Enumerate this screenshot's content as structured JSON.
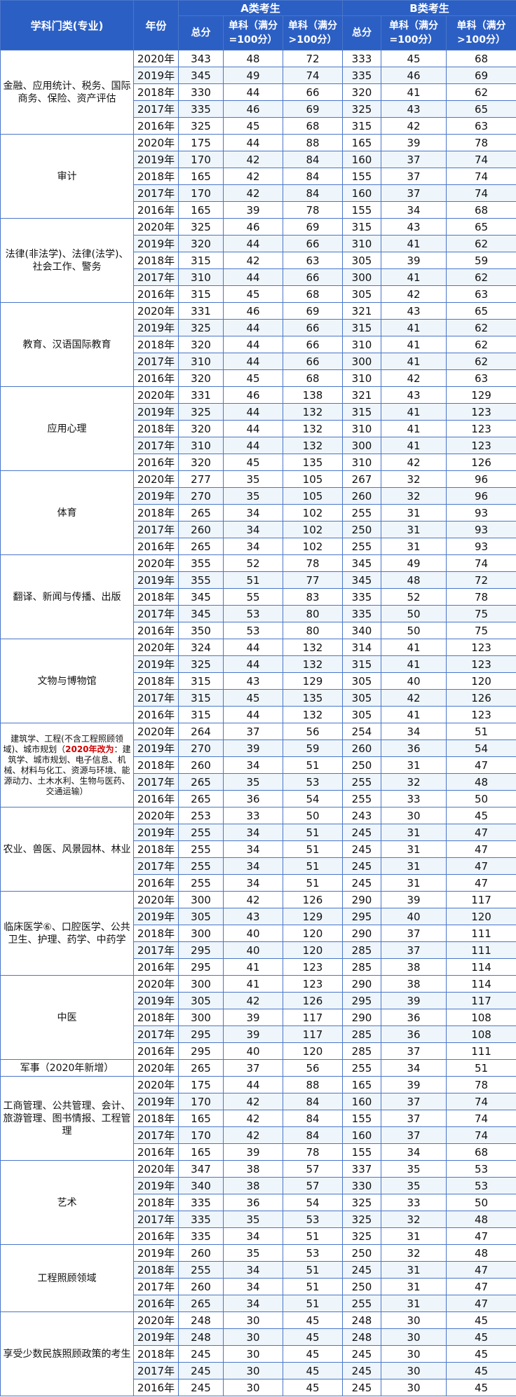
{
  "header": {
    "category": "学科门类(专业)",
    "year": "年份",
    "group_a": "A类考生",
    "group_b": "B类考生",
    "total": "总分",
    "single_100": "单科（满分=100分）",
    "single_over100": "单科（满分>100分）"
  },
  "groups": [
    {
      "name": "金融、应用统计、税务、国际商务、保险、资产评估",
      "rows": [
        [
          "2020年",
          "343",
          "48",
          "72",
          "333",
          "45",
          "68"
        ],
        [
          "2019年",
          "345",
          "49",
          "74",
          "335",
          "46",
          "69"
        ],
        [
          "2018年",
          "330",
          "44",
          "66",
          "320",
          "41",
          "62"
        ],
        [
          "2017年",
          "335",
          "46",
          "69",
          "325",
          "43",
          "65"
        ],
        [
          "2016年",
          "325",
          "45",
          "68",
          "315",
          "42",
          "63"
        ]
      ]
    },
    {
      "name": "审计",
      "rows": [
        [
          "2020年",
          "175",
          "44",
          "88",
          "165",
          "39",
          "78"
        ],
        [
          "2019年",
          "170",
          "42",
          "84",
          "160",
          "37",
          "74"
        ],
        [
          "2018年",
          "165",
          "42",
          "84",
          "155",
          "37",
          "74"
        ],
        [
          "2017年",
          "170",
          "42",
          "84",
          "160",
          "37",
          "74"
        ],
        [
          "2016年",
          "165",
          "39",
          "78",
          "155",
          "34",
          "68"
        ]
      ]
    },
    {
      "name": "法律(非法学)、法律(法学)、社会工作、警务",
      "rows": [
        [
          "2020年",
          "325",
          "46",
          "69",
          "315",
          "43",
          "65"
        ],
        [
          "2019年",
          "320",
          "44",
          "66",
          "310",
          "41",
          "62"
        ],
        [
          "2018年",
          "315",
          "42",
          "63",
          "305",
          "39",
          "59"
        ],
        [
          "2017年",
          "310",
          "44",
          "66",
          "300",
          "41",
          "62"
        ],
        [
          "2016年",
          "315",
          "45",
          "68",
          "305",
          "42",
          "63"
        ]
      ]
    },
    {
      "name": "教育、汉语国际教育",
      "rows": [
        [
          "2020年",
          "331",
          "46",
          "69",
          "321",
          "43",
          "65"
        ],
        [
          "2019年",
          "325",
          "44",
          "66",
          "315",
          "41",
          "62"
        ],
        [
          "2018年",
          "320",
          "44",
          "66",
          "310",
          "41",
          "62"
        ],
        [
          "2017年",
          "310",
          "44",
          "66",
          "300",
          "41",
          "62"
        ],
        [
          "2016年",
          "320",
          "45",
          "68",
          "310",
          "42",
          "63"
        ]
      ]
    },
    {
      "name": "应用心理",
      "rows": [
        [
          "2020年",
          "331",
          "46",
          "138",
          "321",
          "43",
          "129"
        ],
        [
          "2019年",
          "325",
          "44",
          "132",
          "315",
          "41",
          "123"
        ],
        [
          "2018年",
          "320",
          "44",
          "132",
          "310",
          "41",
          "123"
        ],
        [
          "2017年",
          "310",
          "44",
          "132",
          "300",
          "41",
          "123"
        ],
        [
          "2016年",
          "320",
          "45",
          "135",
          "310",
          "42",
          "126"
        ]
      ]
    },
    {
      "name": "体育",
      "rows": [
        [
          "2020年",
          "277",
          "35",
          "105",
          "267",
          "32",
          "96"
        ],
        [
          "2019年",
          "270",
          "35",
          "105",
          "260",
          "32",
          "96"
        ],
        [
          "2018年",
          "265",
          "34",
          "102",
          "255",
          "31",
          "93"
        ],
        [
          "2017年",
          "260",
          "34",
          "102",
          "250",
          "31",
          "93"
        ],
        [
          "2016年",
          "265",
          "34",
          "102",
          "255",
          "31",
          "93"
        ]
      ]
    },
    {
      "name": "翻译、新闻与传播、出版",
      "rows": [
        [
          "2020年",
          "355",
          "52",
          "78",
          "345",
          "49",
          "74"
        ],
        [
          "2019年",
          "355",
          "51",
          "77",
          "345",
          "48",
          "72"
        ],
        [
          "2018年",
          "345",
          "55",
          "83",
          "335",
          "52",
          "78"
        ],
        [
          "2017年",
          "345",
          "53",
          "80",
          "335",
          "50",
          "75"
        ],
        [
          "2016年",
          "350",
          "53",
          "80",
          "340",
          "50",
          "75"
        ]
      ]
    },
    {
      "name": "文物与博物馆",
      "rows": [
        [
          "2020年",
          "324",
          "44",
          "132",
          "314",
          "41",
          "123"
        ],
        [
          "2019年",
          "325",
          "44",
          "132",
          "315",
          "41",
          "123"
        ],
        [
          "2018年",
          "315",
          "43",
          "129",
          "305",
          "40",
          "120"
        ],
        [
          "2017年",
          "315",
          "45",
          "135",
          "305",
          "42",
          "126"
        ],
        [
          "2016年",
          "315",
          "44",
          "132",
          "305",
          "41",
          "123"
        ]
      ]
    },
    {
      "name": "建筑学、工程(不含工程照顾领域)、城市规划（",
      "name_red": "2020年改为",
      "name_tail": "：建筑学、城市规划、电子信息、机械、材料与化工、资源与环境、能源动力、土木水利、生物与医药、交通运输）",
      "rows": [
        [
          "2020年",
          "264",
          "37",
          "56",
          "254",
          "34",
          "51"
        ],
        [
          "2019年",
          "270",
          "39",
          "59",
          "260",
          "36",
          "54"
        ],
        [
          "2018年",
          "260",
          "34",
          "51",
          "250",
          "31",
          "47"
        ],
        [
          "2017年",
          "265",
          "35",
          "53",
          "255",
          "32",
          "48"
        ],
        [
          "2016年",
          "265",
          "36",
          "54",
          "255",
          "33",
          "50"
        ]
      ]
    },
    {
      "name": "农业、兽医、风景园林、林业",
      "rows": [
        [
          "2020年",
          "253",
          "33",
          "50",
          "243",
          "30",
          "45"
        ],
        [
          "2019年",
          "255",
          "34",
          "51",
          "245",
          "31",
          "47"
        ],
        [
          "2018年",
          "255",
          "34",
          "51",
          "245",
          "31",
          "47"
        ],
        [
          "2017年",
          "255",
          "34",
          "51",
          "245",
          "31",
          "47"
        ],
        [
          "2016年",
          "255",
          "34",
          "51",
          "245",
          "31",
          "47"
        ]
      ]
    },
    {
      "name": "临床医学⑥、口腔医学、公共卫生、护理、药学、中药学",
      "rows": [
        [
          "2020年",
          "300",
          "42",
          "126",
          "290",
          "39",
          "117"
        ],
        [
          "2019年",
          "305",
          "43",
          "129",
          "295",
          "40",
          "120"
        ],
        [
          "2018年",
          "300",
          "40",
          "120",
          "290",
          "37",
          "111"
        ],
        [
          "2017年",
          "295",
          "40",
          "120",
          "285",
          "37",
          "111"
        ],
        [
          "2016年",
          "295",
          "41",
          "123",
          "285",
          "38",
          "114"
        ]
      ]
    },
    {
      "name": "中医",
      "rows": [
        [
          "2020年",
          "300",
          "41",
          "123",
          "290",
          "38",
          "114"
        ],
        [
          "2019年",
          "305",
          "42",
          "126",
          "295",
          "39",
          "117"
        ],
        [
          "2018年",
          "300",
          "39",
          "117",
          "290",
          "36",
          "108"
        ],
        [
          "2017年",
          "295",
          "39",
          "117",
          "285",
          "36",
          "108"
        ],
        [
          "2016年",
          "295",
          "40",
          "120",
          "285",
          "37",
          "111"
        ]
      ]
    },
    {
      "name": "军事（2020年新增）",
      "rows": [
        [
          "2020年",
          "265",
          "37",
          "56",
          "255",
          "34",
          "51"
        ]
      ]
    },
    {
      "name": "工商管理、公共管理、会计、旅游管理、图书情报、工程管理",
      "rows": [
        [
          "2020年",
          "175",
          "44",
          "88",
          "165",
          "39",
          "78"
        ],
        [
          "2019年",
          "170",
          "42",
          "84",
          "160",
          "37",
          "74"
        ],
        [
          "2018年",
          "165",
          "42",
          "84",
          "155",
          "37",
          "74"
        ],
        [
          "2017年",
          "170",
          "42",
          "84",
          "160",
          "37",
          "74"
        ],
        [
          "2016年",
          "165",
          "39",
          "78",
          "155",
          "34",
          "68"
        ]
      ]
    },
    {
      "name": "艺术",
      "rows": [
        [
          "2020年",
          "347",
          "38",
          "57",
          "337",
          "35",
          "53"
        ],
        [
          "2019年",
          "340",
          "38",
          "57",
          "330",
          "35",
          "53"
        ],
        [
          "2018年",
          "335",
          "36",
          "54",
          "325",
          "33",
          "50"
        ],
        [
          "2017年",
          "335",
          "35",
          "53",
          "325",
          "32",
          "48"
        ],
        [
          "2016年",
          "335",
          "34",
          "51",
          "325",
          "31",
          "47"
        ]
      ]
    },
    {
      "name": "工程照顾领域",
      "rows": [
        [
          "2019年",
          "260",
          "35",
          "53",
          "250",
          "32",
          "48"
        ],
        [
          "2018年",
          "255",
          "34",
          "51",
          "245",
          "31",
          "47"
        ],
        [
          "2017年",
          "260",
          "34",
          "51",
          "250",
          "31",
          "47"
        ],
        [
          "2016年",
          "265",
          "34",
          "51",
          "255",
          "31",
          "47"
        ]
      ]
    },
    {
      "name": "享受少数民族照顾政策的考生",
      "rows": [
        [
          "2020年",
          "248",
          "30",
          "45",
          "248",
          "30",
          "45"
        ],
        [
          "2019年",
          "248",
          "30",
          "45",
          "248",
          "30",
          "45"
        ],
        [
          "2018年",
          "245",
          "30",
          "45",
          "245",
          "30",
          "45"
        ],
        [
          "2017年",
          "245",
          "30",
          "45",
          "245",
          "30",
          "45"
        ],
        [
          "2016年",
          "245",
          "30",
          "45",
          "245",
          "30",
          "45"
        ]
      ]
    }
  ]
}
